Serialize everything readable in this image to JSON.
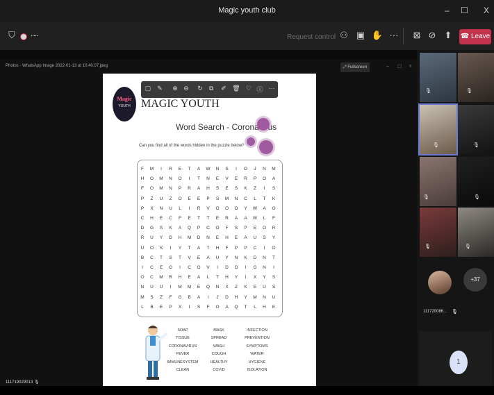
{
  "window": {
    "title": "Magic youth club",
    "minimize": "–",
    "maximize": "☐",
    "close": "X"
  },
  "toolbar": {
    "request_control": "Request control",
    "leave_label": "Leave",
    "icons": [
      "shield-icon",
      "record-icon",
      "more-dots-icon",
      "people-icon",
      "chat-icon",
      "reactions-icon",
      "ellipsis-icon",
      "camera-off-icon",
      "mic-off-icon",
      "share-icon"
    ]
  },
  "share": {
    "title": "Photos - WhatsApp Image 2022-01-13 at 10.40.07.jpeg",
    "fullscreen": "Fullscreen"
  },
  "document": {
    "logo_text": "Magic",
    "logo_sub": "YOUTH",
    "brand": "MAGIC YOUTH",
    "title": "Word Search - Coronavirus",
    "question": "Can you find all of the words hidden in the puzzle below?",
    "grid": [
      [
        "F",
        "M",
        "I",
        "R",
        "E",
        "T",
        "A",
        "W",
        "N",
        "S",
        "I",
        "O",
        "J",
        "N",
        "M"
      ],
      [
        "H",
        "O",
        "M",
        "N",
        "O",
        "I",
        "T",
        "N",
        "E",
        "V",
        "E",
        "R",
        "P",
        "O",
        "A"
      ],
      [
        "F",
        "O",
        "M",
        "N",
        "P",
        "R",
        "A",
        "H",
        "S",
        "E",
        "S",
        "K",
        "Z",
        "I",
        "S"
      ],
      [
        "P",
        "Z",
        "U",
        "Z",
        "O",
        "E",
        "E",
        "P",
        "S",
        "M",
        "N",
        "C",
        "L",
        "T",
        "K"
      ],
      [
        "P",
        "X",
        "N",
        "U",
        "L",
        "I",
        "R",
        "V",
        "O",
        "O",
        "O",
        "Y",
        "W",
        "A",
        "O"
      ],
      [
        "C",
        "H",
        "E",
        "C",
        "F",
        "E",
        "T",
        "T",
        "E",
        "R",
        "A",
        "A",
        "W",
        "L",
        "F"
      ],
      [
        "D",
        "G",
        "S",
        "K",
        "A",
        "Q",
        "P",
        "C",
        "O",
        "F",
        "S",
        "P",
        "E",
        "O",
        "R"
      ],
      [
        "R",
        "U",
        "Y",
        "D",
        "H",
        "M",
        "D",
        "N",
        "E",
        "H",
        "E",
        "A",
        "U",
        "S",
        "Y"
      ],
      [
        "U",
        "O",
        "S",
        "I",
        "Y",
        "T",
        "A",
        "T",
        "H",
        "F",
        "P",
        "P",
        "C",
        "I",
        "O"
      ],
      [
        "B",
        "C",
        "T",
        "S",
        "T",
        "V",
        "E",
        "A",
        "U",
        "Y",
        "N",
        "K",
        "D",
        "N",
        "T"
      ],
      [
        "I",
        "C",
        "E",
        "O",
        "I",
        "C",
        "O",
        "V",
        "I",
        "D",
        "G",
        "I",
        "G",
        "N",
        "I"
      ],
      [
        "O",
        "C",
        "M",
        "R",
        "H",
        "E",
        "A",
        "L",
        "T",
        "H",
        "Y",
        "I",
        "X",
        "Y",
        "S"
      ],
      [
        "N",
        "U",
        "U",
        "I",
        "M",
        "M",
        "E",
        "Q",
        "N",
        "X",
        "Z",
        "K",
        "E",
        "U",
        "S"
      ],
      [
        "M",
        "S",
        "Z",
        "F",
        "G",
        "B",
        "A",
        "I",
        "J",
        "D",
        "H",
        "Y",
        "M",
        "N",
        "U"
      ],
      [
        "L",
        "B",
        "E",
        "P",
        "X",
        "I",
        "S",
        "F",
        "O",
        "A",
        "Q",
        "T",
        "L",
        "H",
        "E"
      ]
    ],
    "words": [
      [
        "SOAP",
        "MASK",
        "INFECTION"
      ],
      [
        "TISSUE",
        "SPREAD",
        "PREVENTION"
      ],
      [
        "CORONAVIRUS",
        "WASH",
        "SYMPTOMS"
      ],
      [
        "FEVER",
        "COUGH",
        "WATER"
      ],
      [
        "IMMUNESYSTEM",
        "HEALTHY",
        "HYGIENE"
      ],
      [
        "CLEAN",
        "COVID",
        "ISOLATION"
      ]
    ]
  },
  "gallery": {
    "participant_name": "111720086...",
    "more_count": "+37",
    "bottom_name": "111719029013",
    "page_number": "1"
  },
  "colors": {
    "leave": "#c4314b",
    "virus": "#a05aa0",
    "background": "#0b0b0b"
  }
}
